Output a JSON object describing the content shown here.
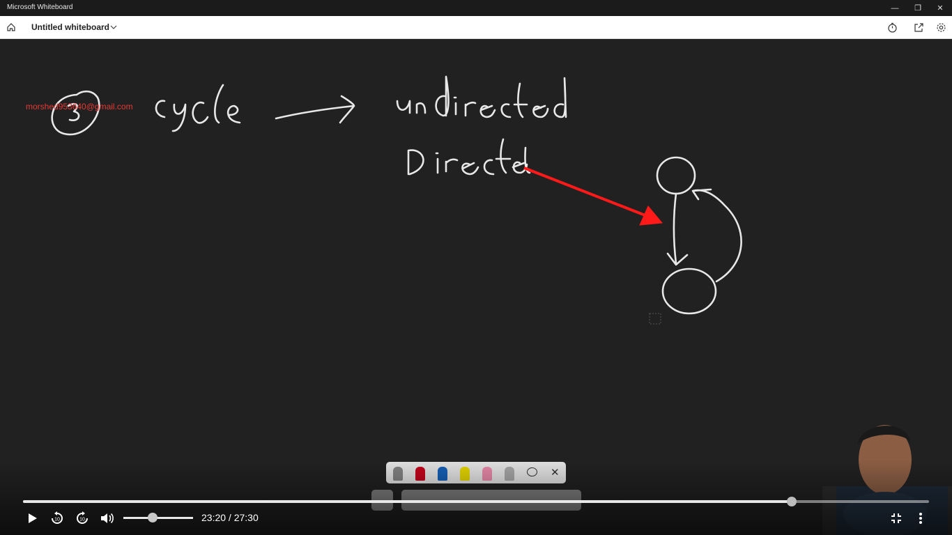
{
  "window": {
    "title": "Microsoft Whiteboard",
    "controls": [
      "minimize-icon",
      "restore-icon",
      "close-icon"
    ]
  },
  "toolbar": {
    "board_title": "Untitled whiteboard",
    "icons": [
      "home-icon",
      "chevron-down-icon",
      "timer-icon",
      "share-icon",
      "settings-icon"
    ]
  },
  "canvas": {
    "watermark_email": "morshed953640@gmail.com",
    "ink_color": "#e8e8e8",
    "arrow_color": "#ff1a1a"
  },
  "ink_palette": {
    "tools": [
      "pen-black",
      "pen-red",
      "pen-blue",
      "highlighter-yellow",
      "highlighter-pink",
      "eraser",
      "lasso"
    ],
    "pen_colors": [
      "#555555",
      "#d0021b",
      "#1565c0",
      "#f2e200",
      "#f48fb1",
      "#b0b0b0"
    ]
  },
  "player": {
    "current_time": "23:20",
    "total_time": "27:30",
    "time_text": "23:20 / 27:30",
    "progress": 0.8485,
    "volume": 0.42,
    "accent": "#ffffff"
  }
}
